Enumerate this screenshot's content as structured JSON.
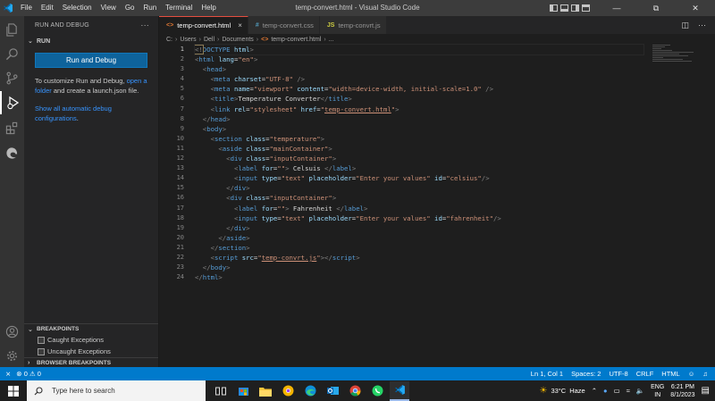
{
  "window": {
    "title": "temp-convert.html - Visual Studio Code",
    "menu": [
      "File",
      "Edit",
      "Selection",
      "View",
      "Go",
      "Run",
      "Terminal",
      "Help"
    ]
  },
  "sidebar": {
    "header": "RUN AND DEBUG",
    "more": "···",
    "section": "RUN",
    "run_button": "Run and Debug",
    "customize_text_1": "To customize Run and Debug, ",
    "customize_link": "open a folder",
    "customize_text_2": " and create a launch.json file.",
    "show_link": "Show all automatic debug configurations",
    "show_suffix": ".",
    "breakpoints": {
      "header": "BREAKPOINTS",
      "items": [
        "Caught Exceptions",
        "Uncaught Exceptions"
      ]
    },
    "browser_breakpoints": "BROWSER BREAKPOINTS"
  },
  "tabs": [
    {
      "icon": "<>",
      "label": "temp-convert.html",
      "close": "×"
    },
    {
      "icon": "#",
      "label": "temp-convert.css"
    },
    {
      "icon": "JS",
      "label": "temp-convrt.js"
    }
  ],
  "breadcrumb": [
    "C:",
    "Users",
    "Dell",
    "Documents",
    "temp-convert.html",
    "..."
  ],
  "editor": {
    "line_numbers": [
      "1",
      "2",
      "3",
      "4",
      "5",
      "6",
      "7",
      "8",
      "9",
      "10",
      "11",
      "12",
      "13",
      "14",
      "15",
      "16",
      "17",
      "18",
      "19",
      "20",
      "21",
      "22",
      "23",
      "24"
    ],
    "lines": [
      [
        {
          "c": "pn",
          "t": "<!"
        },
        {
          "c": "tg",
          "t": "DOCTYPE"
        },
        {
          "c": "at",
          "t": " html"
        },
        {
          "c": "pn",
          "t": ">"
        }
      ],
      [
        {
          "c": "pn",
          "t": "<"
        },
        {
          "c": "tg",
          "t": "html"
        },
        {
          "c": "at",
          "t": " lang"
        },
        {
          "c": "tx",
          "t": "="
        },
        {
          "c": "st",
          "t": "\"en\""
        },
        {
          "c": "pn",
          "t": ">"
        }
      ],
      [
        {
          "c": "tx",
          "t": "  "
        },
        {
          "c": "pn",
          "t": "<"
        },
        {
          "c": "tg",
          "t": "head"
        },
        {
          "c": "pn",
          "t": ">"
        }
      ],
      [
        {
          "c": "tx",
          "t": "    "
        },
        {
          "c": "pn",
          "t": "<"
        },
        {
          "c": "tg",
          "t": "meta"
        },
        {
          "c": "at",
          "t": " charset"
        },
        {
          "c": "tx",
          "t": "="
        },
        {
          "c": "st",
          "t": "\"UTF-8\""
        },
        {
          "c": "pn",
          "t": " />"
        }
      ],
      [
        {
          "c": "tx",
          "t": "    "
        },
        {
          "c": "pn",
          "t": "<"
        },
        {
          "c": "tg",
          "t": "meta"
        },
        {
          "c": "at",
          "t": " name"
        },
        {
          "c": "tx",
          "t": "="
        },
        {
          "c": "st",
          "t": "\"viewport\""
        },
        {
          "c": "at",
          "t": " content"
        },
        {
          "c": "tx",
          "t": "="
        },
        {
          "c": "st",
          "t": "\"width=device-width, initial-scale=1.0\""
        },
        {
          "c": "pn",
          "t": " />"
        }
      ],
      [
        {
          "c": "tx",
          "t": "    "
        },
        {
          "c": "pn",
          "t": "<"
        },
        {
          "c": "tg",
          "t": "title"
        },
        {
          "c": "pn",
          "t": ">"
        },
        {
          "c": "tx",
          "t": "Temperature Converter"
        },
        {
          "c": "pn",
          "t": "</"
        },
        {
          "c": "tg",
          "t": "title"
        },
        {
          "c": "pn",
          "t": ">"
        }
      ],
      [
        {
          "c": "tx",
          "t": "    "
        },
        {
          "c": "pn",
          "t": "<"
        },
        {
          "c": "tg",
          "t": "link"
        },
        {
          "c": "at",
          "t": " rel"
        },
        {
          "c": "tx",
          "t": "="
        },
        {
          "c": "st",
          "t": "\"stylesheet\""
        },
        {
          "c": "at",
          "t": " href"
        },
        {
          "c": "tx",
          "t": "="
        },
        {
          "c": "st",
          "t": "\""
        },
        {
          "c": "st ul",
          "t": "temp-convert.html"
        },
        {
          "c": "st",
          "t": "\""
        },
        {
          "c": "pn",
          "t": ">"
        }
      ],
      [
        {
          "c": "tx",
          "t": "  "
        },
        {
          "c": "pn",
          "t": "</"
        },
        {
          "c": "tg",
          "t": "head"
        },
        {
          "c": "pn",
          "t": ">"
        }
      ],
      [
        {
          "c": "tx",
          "t": "  "
        },
        {
          "c": "pn",
          "t": "<"
        },
        {
          "c": "tg",
          "t": "body"
        },
        {
          "c": "pn",
          "t": ">"
        }
      ],
      [
        {
          "c": "tx",
          "t": "    "
        },
        {
          "c": "pn",
          "t": "<"
        },
        {
          "c": "tg",
          "t": "section"
        },
        {
          "c": "at",
          "t": " class"
        },
        {
          "c": "tx",
          "t": "="
        },
        {
          "c": "st",
          "t": "\"temperature\""
        },
        {
          "c": "pn",
          "t": ">"
        }
      ],
      [
        {
          "c": "tx",
          "t": "      "
        },
        {
          "c": "pn",
          "t": "<"
        },
        {
          "c": "tg",
          "t": "aside"
        },
        {
          "c": "at",
          "t": " class"
        },
        {
          "c": "tx",
          "t": "="
        },
        {
          "c": "st",
          "t": "\"mainContainer\""
        },
        {
          "c": "pn",
          "t": ">"
        }
      ],
      [
        {
          "c": "tx",
          "t": "        "
        },
        {
          "c": "pn",
          "t": "<"
        },
        {
          "c": "tg",
          "t": "div"
        },
        {
          "c": "at",
          "t": " class"
        },
        {
          "c": "tx",
          "t": "="
        },
        {
          "c": "st",
          "t": "\"inputContainer\""
        },
        {
          "c": "pn",
          "t": ">"
        }
      ],
      [
        {
          "c": "tx",
          "t": "          "
        },
        {
          "c": "pn",
          "t": "<"
        },
        {
          "c": "tg",
          "t": "label"
        },
        {
          "c": "at",
          "t": " for"
        },
        {
          "c": "tx",
          "t": "="
        },
        {
          "c": "st",
          "t": "\"\""
        },
        {
          "c": "pn",
          "t": ">"
        },
        {
          "c": "tx",
          "t": " Celsuis "
        },
        {
          "c": "pn",
          "t": "</"
        },
        {
          "c": "tg",
          "t": "label"
        },
        {
          "c": "pn",
          "t": ">"
        }
      ],
      [
        {
          "c": "tx",
          "t": "          "
        },
        {
          "c": "pn",
          "t": "<"
        },
        {
          "c": "tg",
          "t": "input"
        },
        {
          "c": "at",
          "t": " type"
        },
        {
          "c": "tx",
          "t": "="
        },
        {
          "c": "st",
          "t": "\"text\""
        },
        {
          "c": "at",
          "t": " placeholder"
        },
        {
          "c": "tx",
          "t": "="
        },
        {
          "c": "st",
          "t": "\"Enter your values\""
        },
        {
          "c": "at",
          "t": " id"
        },
        {
          "c": "tx",
          "t": "="
        },
        {
          "c": "st",
          "t": "\"celsius\""
        },
        {
          "c": "pn",
          "t": "/>"
        }
      ],
      [
        {
          "c": "tx",
          "t": "        "
        },
        {
          "c": "pn",
          "t": "</"
        },
        {
          "c": "tg",
          "t": "div"
        },
        {
          "c": "pn",
          "t": ">"
        }
      ],
      [
        {
          "c": "tx",
          "t": "        "
        },
        {
          "c": "pn",
          "t": "<"
        },
        {
          "c": "tg",
          "t": "div"
        },
        {
          "c": "at",
          "t": " class"
        },
        {
          "c": "tx",
          "t": "="
        },
        {
          "c": "st",
          "t": "\"inputContainer\""
        },
        {
          "c": "pn",
          "t": ">"
        }
      ],
      [
        {
          "c": "tx",
          "t": "          "
        },
        {
          "c": "pn",
          "t": "<"
        },
        {
          "c": "tg",
          "t": "label"
        },
        {
          "c": "at",
          "t": " for"
        },
        {
          "c": "tx",
          "t": "="
        },
        {
          "c": "st",
          "t": "\"\""
        },
        {
          "c": "pn",
          "t": ">"
        },
        {
          "c": "tx",
          "t": " Fahrenheit "
        },
        {
          "c": "pn",
          "t": "</"
        },
        {
          "c": "tg",
          "t": "label"
        },
        {
          "c": "pn",
          "t": ">"
        }
      ],
      [
        {
          "c": "tx",
          "t": "          "
        },
        {
          "c": "pn",
          "t": "<"
        },
        {
          "c": "tg",
          "t": "input"
        },
        {
          "c": "at",
          "t": " type"
        },
        {
          "c": "tx",
          "t": "="
        },
        {
          "c": "st",
          "t": "\"text\""
        },
        {
          "c": "at",
          "t": " placeholder"
        },
        {
          "c": "tx",
          "t": "="
        },
        {
          "c": "st",
          "t": "\"Enter your values\""
        },
        {
          "c": "at",
          "t": " id"
        },
        {
          "c": "tx",
          "t": "="
        },
        {
          "c": "st",
          "t": "\"fahrenheit\""
        },
        {
          "c": "pn",
          "t": "/>"
        }
      ],
      [
        {
          "c": "tx",
          "t": "        "
        },
        {
          "c": "pn",
          "t": "</"
        },
        {
          "c": "tg",
          "t": "div"
        },
        {
          "c": "pn",
          "t": ">"
        }
      ],
      [
        {
          "c": "tx",
          "t": "      "
        },
        {
          "c": "pn",
          "t": "</"
        },
        {
          "c": "tg",
          "t": "aside"
        },
        {
          "c": "pn",
          "t": ">"
        }
      ],
      [
        {
          "c": "tx",
          "t": "    "
        },
        {
          "c": "pn",
          "t": "</"
        },
        {
          "c": "tg",
          "t": "section"
        },
        {
          "c": "pn",
          "t": ">"
        }
      ],
      [
        {
          "c": "tx",
          "t": "    "
        },
        {
          "c": "pn",
          "t": "<"
        },
        {
          "c": "tg",
          "t": "script"
        },
        {
          "c": "at",
          "t": " src"
        },
        {
          "c": "tx",
          "t": "="
        },
        {
          "c": "st",
          "t": "\""
        },
        {
          "c": "st ul",
          "t": "temp-convrt.js"
        },
        {
          "c": "st",
          "t": "\""
        },
        {
          "c": "pn",
          "t": "></"
        },
        {
          "c": "tg",
          "t": "script"
        },
        {
          "c": "pn",
          "t": ">"
        }
      ],
      [
        {
          "c": "tx",
          "t": "  "
        },
        {
          "c": "pn",
          "t": "</"
        },
        {
          "c": "tg",
          "t": "body"
        },
        {
          "c": "pn",
          "t": ">"
        }
      ],
      [
        {
          "c": "pn",
          "t": "</"
        },
        {
          "c": "tg",
          "t": "html"
        },
        {
          "c": "pn",
          "t": ">"
        }
      ]
    ]
  },
  "statusbar": {
    "remote": "⨯",
    "errors": "0",
    "warnings": "0",
    "position": "Ln 1, Col 1",
    "spaces": "Spaces: 2",
    "encoding": "UTF-8",
    "eol": "CRLF",
    "language": "HTML"
  },
  "taskbar": {
    "search_placeholder": "Type here to search",
    "weather_temp": "33°C",
    "weather_desc": "Haze",
    "lang_1": "ENG",
    "lang_2": "IN",
    "time": "6:21 PM",
    "date": "8/1/2023"
  },
  "colors": {
    "accent": "#007acc",
    "run_button": "#0e639c",
    "active_tab_border": "#e54e3f"
  }
}
